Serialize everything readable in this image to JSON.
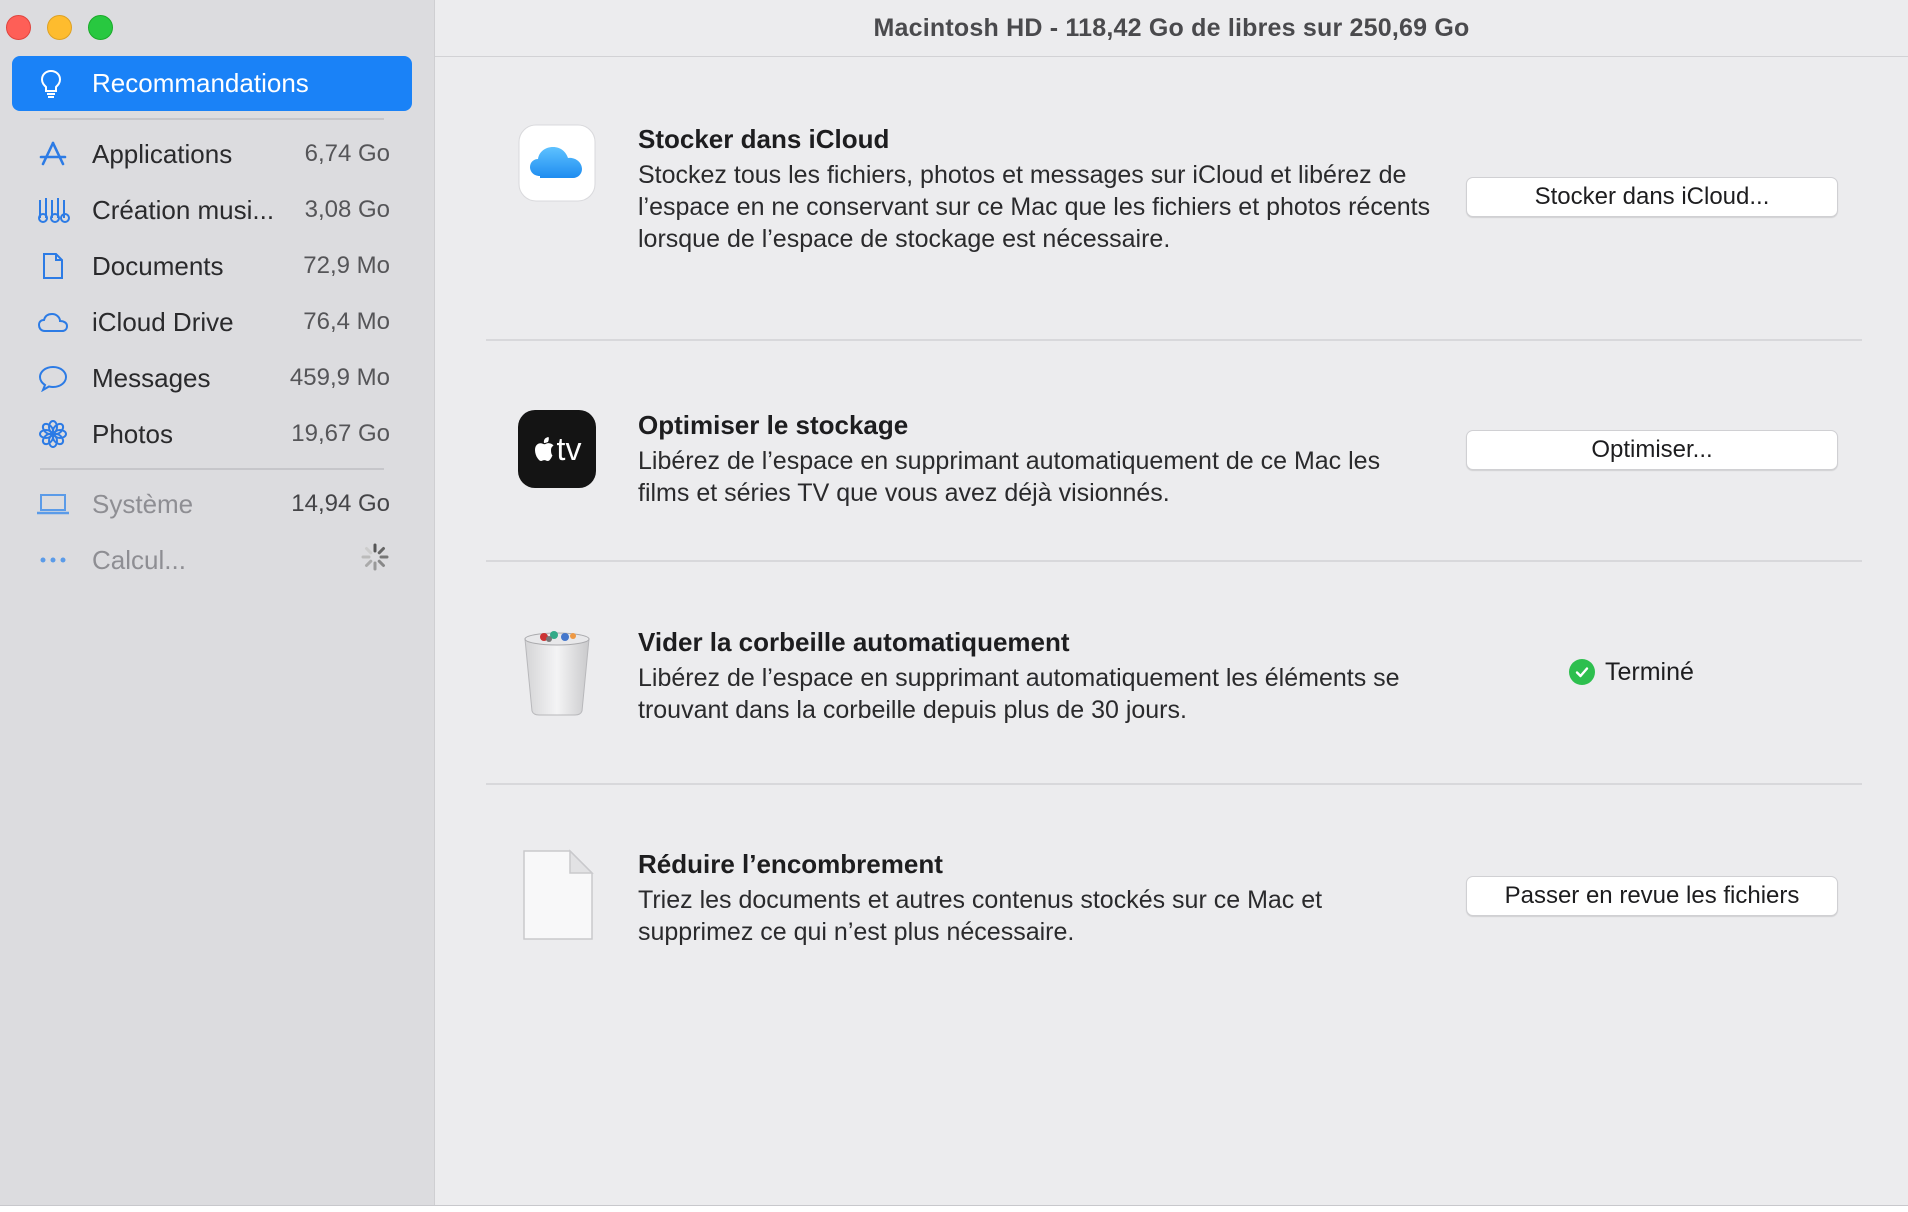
{
  "window": {
    "title": "Macintosh HD - 118,42 Go de libres sur 250,69 Go"
  },
  "sidebar": {
    "selected": {
      "label": "Recommandations",
      "icon": "lightbulb-icon"
    },
    "items": [
      {
        "label": "Applications",
        "size": "6,74 Go",
        "icon": "app-store-icon"
      },
      {
        "label": "Création musi...",
        "size": "3,08 Go",
        "icon": "music-creation-icon"
      },
      {
        "label": "Documents",
        "size": "72,9 Mo",
        "icon": "document-icon"
      },
      {
        "label": "iCloud Drive",
        "size": "76,4 Mo",
        "icon": "cloud-icon"
      },
      {
        "label": "Messages",
        "size": "459,9 Mo",
        "icon": "message-bubble-icon"
      },
      {
        "label": "Photos",
        "size": "19,67 Go",
        "icon": "photos-flower-icon"
      }
    ],
    "system": {
      "label": "Système",
      "size": "14,94 Go",
      "icon": "laptop-icon"
    },
    "calculating": {
      "label": "Calcul...",
      "icon": "ellipsis-icon"
    }
  },
  "recommendations": [
    {
      "title": "Stocker dans iCloud",
      "description": "Stockez tous les fichiers, photos et messages sur iCloud et libérez de l’espace en ne conservant sur ce Mac que les fichiers et photos récents lorsque de l’espace de stockage est nécessaire.",
      "button": "Stocker dans iCloud...",
      "icon": "icloud-icon"
    },
    {
      "title": "Optimiser le stockage",
      "description": "Libérez de l’espace en supprimant automatiquement de ce Mac les films et séries TV que vous avez déjà visionnés.",
      "button": "Optimiser...",
      "icon": "apple-tv-icon",
      "icon_text": "tv"
    },
    {
      "title": "Vider la corbeille automatiquement",
      "description": "Libérez de l’espace en supprimant automatiquement les éléments se trouvant dans la corbeille depuis plus de 30 jours.",
      "status": "Terminé",
      "icon": "trash-icon"
    },
    {
      "title": "Réduire l’encombrement",
      "description": "Triez les documents et autres contenus stockés sur ce Mac et supprimez ce qui n’est plus nécessaire.",
      "button": "Passer en revue les fichiers",
      "icon": "blank-document-icon"
    }
  ],
  "colors": {
    "accent": "#1a82f7",
    "success": "#2dbf4e",
    "sidebar_bg": "#dcdcdf",
    "content_bg": "#ececee"
  }
}
